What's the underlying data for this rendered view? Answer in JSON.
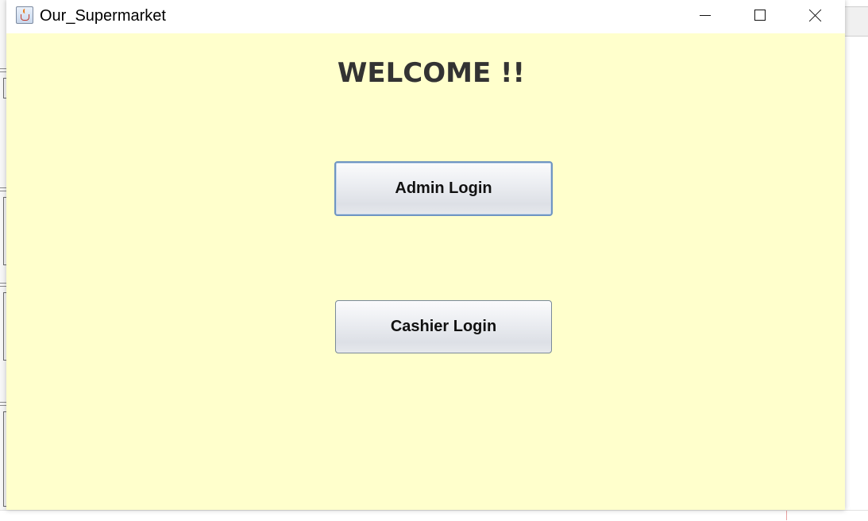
{
  "window": {
    "title": "Our_Supermarket",
    "icon": "java-cup-icon",
    "controls": {
      "minimize": "minimize-icon",
      "maximize": "maximize-icon",
      "close": "close-icon"
    }
  },
  "main": {
    "heading": "WELCOME !!",
    "buttons": {
      "admin_login": "Admin Login",
      "cashier_login": "Cashier Login"
    }
  },
  "colors": {
    "content_background": "#ffffcc",
    "heading_text": "#333333",
    "button_focus_border": "#6f95c2"
  }
}
